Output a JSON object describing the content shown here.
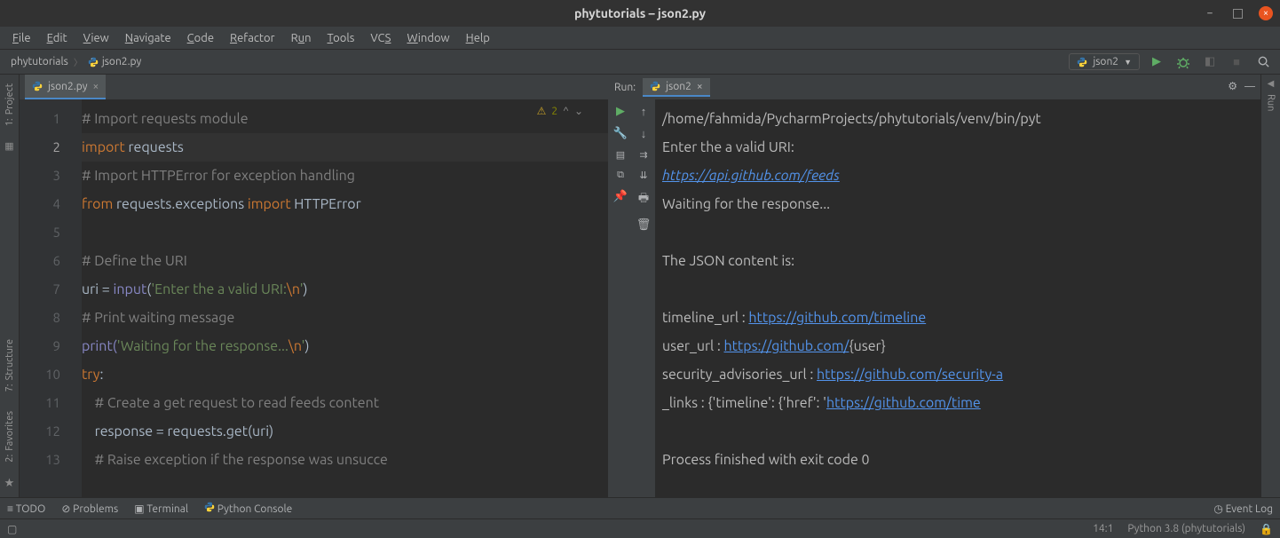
{
  "window": {
    "title": "phytutorials – json2.py"
  },
  "menu": [
    "File",
    "Edit",
    "View",
    "Navigate",
    "Code",
    "Refactor",
    "Run",
    "Tools",
    "VCS",
    "Window",
    "Help"
  ],
  "breadcrumbs": {
    "project": "phytutorials",
    "file": "json2.py"
  },
  "run_config": {
    "name": "json2"
  },
  "editor_tab": {
    "name": "json2.py"
  },
  "warnings": {
    "count": "2"
  },
  "code": {
    "l1": "# Import requests module",
    "l2a": "import ",
    "l2b": "requests",
    "l3": "# Import HTTPError for exception handling",
    "l4a": "from ",
    "l4b": "requests.exceptions ",
    "l4c": "import ",
    "l4d": "HTTPError",
    "l5": "",
    "l6": "# Define the URI",
    "l7a": "uri = ",
    "l7b": "input",
    "l7c": "(",
    "l7d": "'Enter the a valid URI:",
    "l7e": "\\n",
    "l7f": "'",
    "l7g": ")",
    "l8": "# Print waiting message",
    "l9a": "print(",
    "l9b": "'Waiting for the response...",
    "l9c": "\\n",
    "l9d": "'",
    "l9e": ")",
    "l10a": "try",
    "l10b": ":",
    "l11": "    # Create a get request to read feeds content",
    "l12": "    response = requests.get(uri)",
    "l13": "    # Raise exception if the response was unsucce"
  },
  "run_panel": {
    "label": "Run:",
    "tab": "json2",
    "out_path": "/home/fahmida/PycharmProjects/phytutorials/venv/bin/pyt",
    "prompt": "Enter the a valid URI:",
    "uri": "https://api.github.com/feeds",
    "waiting": "Waiting for the response...",
    "json_hdr": "The JSON content is:",
    "tl_label": "timeline_url : ",
    "tl_link": "https://github.com/timeline",
    "user_label": "user_url : ",
    "user_link": "https://github.com/",
    "user_suffix": "{user}",
    "sec_label": "security_advisories_url : ",
    "sec_link": "https://github.com/security-a",
    "links_label": "_links : {'timeline': {'href': '",
    "links_link": "https://github.com/time",
    "exit": "Process finished with exit code 0"
  },
  "left_tools": {
    "project": "Project",
    "structure": "Structure",
    "favorites": "Favorites"
  },
  "right_tools": {
    "run": "Run"
  },
  "bottom": {
    "todo": "TODO",
    "problems": "Problems",
    "terminal": "Terminal",
    "pyconsole": "Python Console",
    "eventlog": "Event Log"
  },
  "status": {
    "pos": "14:1",
    "python": "Python 3.8 (phytutorials)"
  }
}
